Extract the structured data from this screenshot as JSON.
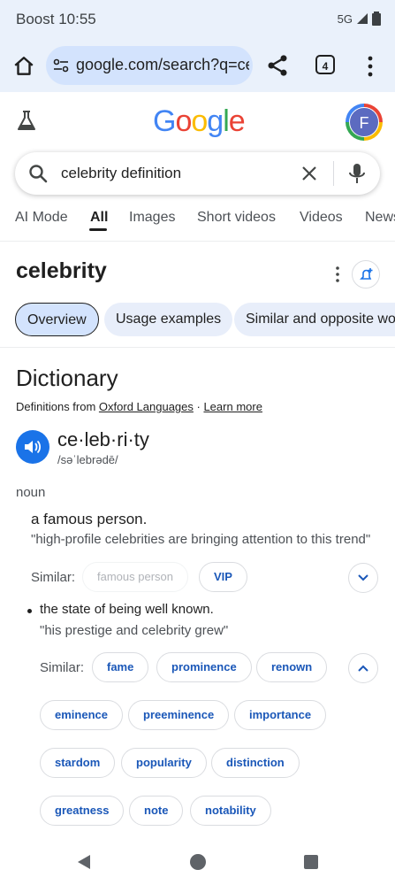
{
  "status": {
    "carrier": "Boost",
    "time": "10:55",
    "network": "5G"
  },
  "browser": {
    "url": "google.com/search?q=celebrity+definition",
    "tab_count": "4"
  },
  "header": {
    "logo": "Google",
    "avatar_letter": "F"
  },
  "search": {
    "query": "celebrity definition"
  },
  "nav_tabs": [
    "AI Mode",
    "All",
    "Images",
    "Short videos",
    "Videos",
    "News"
  ],
  "result": {
    "word": "celebrity",
    "chips": [
      "Overview",
      "Usage examples",
      "Similar and opposite words"
    ]
  },
  "dictionary": {
    "title": "Dictionary",
    "source_prefix": "Definitions from ",
    "source": "Oxford Languages",
    "separator": " · ",
    "learn_more": "Learn more",
    "syllables": "ce·leb·ri·ty",
    "pronunciation": "/səˈlebrədē/",
    "part_of_speech": "noun",
    "sense1": {
      "definition": "a famous person.",
      "example": "\"high-profile celebrities are bringing attention to this trend\"",
      "similar_label": "Similar:",
      "similar": [
        "famous person",
        "VIP"
      ]
    },
    "sense2": {
      "definition": "the state of being well known.",
      "example": "\"his prestige and celebrity grew\"",
      "similar_label": "Similar:",
      "similar": [
        "fame",
        "prominence",
        "renown",
        "eminence",
        "preeminence",
        "importance",
        "stardom",
        "popularity",
        "distinction",
        "greatness",
        "note",
        "notability"
      ]
    }
  },
  "colors": {
    "accent": "#1a73e8",
    "link_chip_text": "#1a57b8",
    "chrome_bg": "#eaf1fb"
  }
}
